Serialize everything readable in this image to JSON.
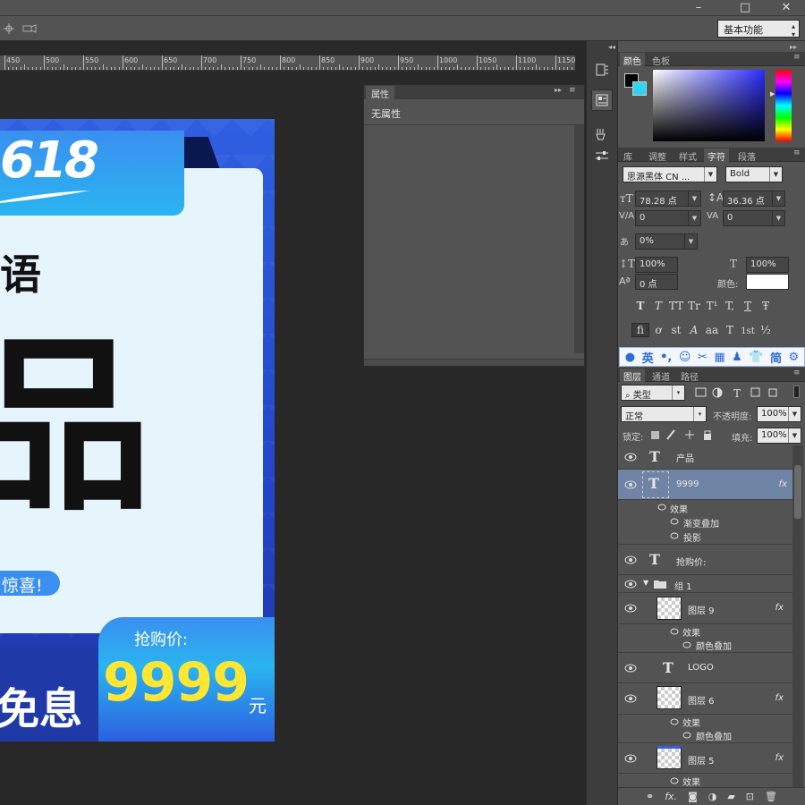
{
  "window": {
    "controls": [
      "–",
      "□",
      "✕"
    ]
  },
  "options_bar": {
    "workspace": "基本功能"
  },
  "ruler": {
    "labels": [
      "450",
      "500",
      "550",
      "600",
      "650",
      "700",
      "750",
      "800",
      "850",
      "900",
      "950",
      "1000",
      "1050",
      "1100",
      "1150"
    ]
  },
  "poster": {
    "badge_text": "618",
    "line1": "语",
    "big_char": "品",
    "pill_text": "惊喜!",
    "interest_text": "免息",
    "price_label": "抢购价:",
    "price_value": "9999",
    "price_unit": "元"
  },
  "properties_panel": {
    "tab": "属性",
    "content": "无属性"
  },
  "color_panel": {
    "tabs": [
      "颜色",
      "色板"
    ],
    "foreground": "#000000",
    "background": "#2fd4f0"
  },
  "character_panel": {
    "tabs": [
      "库",
      "调整",
      "样式",
      "字符",
      "段落"
    ],
    "font_family": "思源黑体 CN ...",
    "font_style": "Bold",
    "font_size": "78.28 点",
    "leading": "36.36 点",
    "kerning": "0",
    "tracking": "0",
    "tsume": "0%",
    "vertical_scale": "100%",
    "horizontal_scale": "100%",
    "baseline_shift": "0 点",
    "color_label": "颜色:",
    "style_glyphs": [
      "T",
      "T",
      "TT",
      "Tr",
      "T¹",
      "T,",
      "T",
      "Ŧ"
    ],
    "opentype_glyphs": [
      "fi",
      "ơ",
      "st",
      "A",
      "aa",
      "T",
      "1st",
      "½"
    ]
  },
  "ime_bar": {
    "lang": "英",
    "punct": "•,",
    "symbols": [
      "☺",
      "✂",
      "▦",
      "♟",
      "👕",
      "简",
      "⚙"
    ]
  },
  "layers_panel": {
    "tabs": [
      "图层",
      "通道",
      "路径"
    ],
    "filter": "类型",
    "blend_mode": "正常",
    "opacity_label": "不透明度:",
    "opacity": "100%",
    "lock_label": "锁定:",
    "fill_label": "填充:",
    "fill": "100%",
    "fx_label": "fx",
    "effects_label": "效果",
    "layers": [
      {
        "name": "产品"
      },
      {
        "name": "9999",
        "effects": [
          "渐变叠加",
          "投影"
        ]
      },
      {
        "name": "抢购价:"
      },
      {
        "name": "组 1"
      },
      {
        "name": "图层 9",
        "effects": [
          "颜色叠加"
        ]
      },
      {
        "name": "LOGO"
      },
      {
        "name": "图层 6",
        "effects": [
          "颜色叠加"
        ]
      },
      {
        "name": "图层 5"
      }
    ]
  }
}
